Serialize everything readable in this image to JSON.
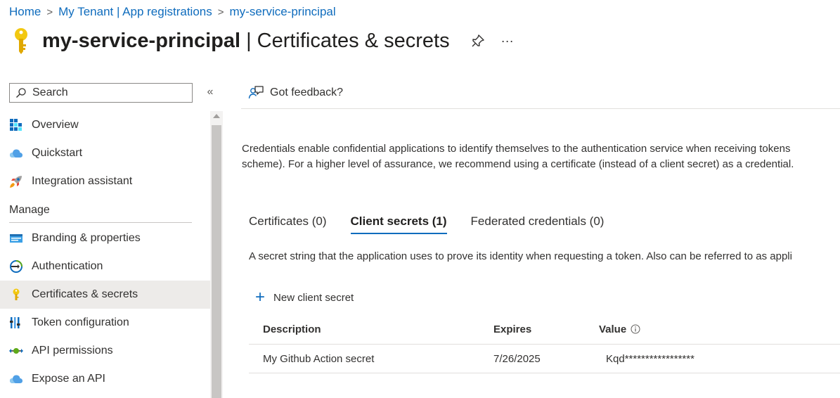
{
  "breadcrumb": {
    "home": "Home",
    "tenant": "My Tenant | App registrations",
    "current": "my-service-principal",
    "separator": ">"
  },
  "title": {
    "main": "my-service-principal",
    "divider": "|",
    "sub": "Certificates & secrets",
    "more": "···"
  },
  "search": {
    "placeholder": "Search"
  },
  "sidebar": {
    "collapse": "«",
    "items": [
      {
        "label": "Overview",
        "icon": "overview-grid-icon"
      },
      {
        "label": "Quickstart",
        "icon": "cloud-icon"
      },
      {
        "label": "Integration assistant",
        "icon": "rocket-icon"
      }
    ],
    "section": "Manage",
    "manage_items": [
      {
        "label": "Branding & properties",
        "icon": "branding-icon"
      },
      {
        "label": "Authentication",
        "icon": "authentication-icon"
      },
      {
        "label": "Certificates & secrets",
        "icon": "key-icon",
        "active": true
      },
      {
        "label": "Token configuration",
        "icon": "token-bars-icon"
      },
      {
        "label": "API permissions",
        "icon": "api-permissions-icon"
      },
      {
        "label": "Expose an API",
        "icon": "cloud-icon"
      }
    ]
  },
  "main": {
    "feedback": "Got feedback?",
    "description_line1": "Credentials enable confidential applications to identify themselves to the authentication service when receiving tokens",
    "description_line2": "scheme). For a higher level of assurance, we recommend using a certificate (instead of a client secret) as a credential.",
    "tabs": [
      {
        "label": "Certificates (0)",
        "active": false
      },
      {
        "label": "Client secrets (1)",
        "active": true
      },
      {
        "label": "Federated credentials (0)",
        "active": false
      }
    ],
    "tab_description": "A secret string that the application uses to prove its identity when requesting a token. Also can be referred to as appli",
    "new_secret_label": "New client secret",
    "table": {
      "headers": [
        "Description",
        "Expires",
        "Value"
      ],
      "rows": [
        {
          "description": "My Github Action secret",
          "expires": "7/26/2025",
          "value": "Kqd*****************"
        }
      ]
    }
  },
  "colors": {
    "accent": "#0f6cbd",
    "active_nav": "#edebe9",
    "key_gold": "#f2c811"
  }
}
